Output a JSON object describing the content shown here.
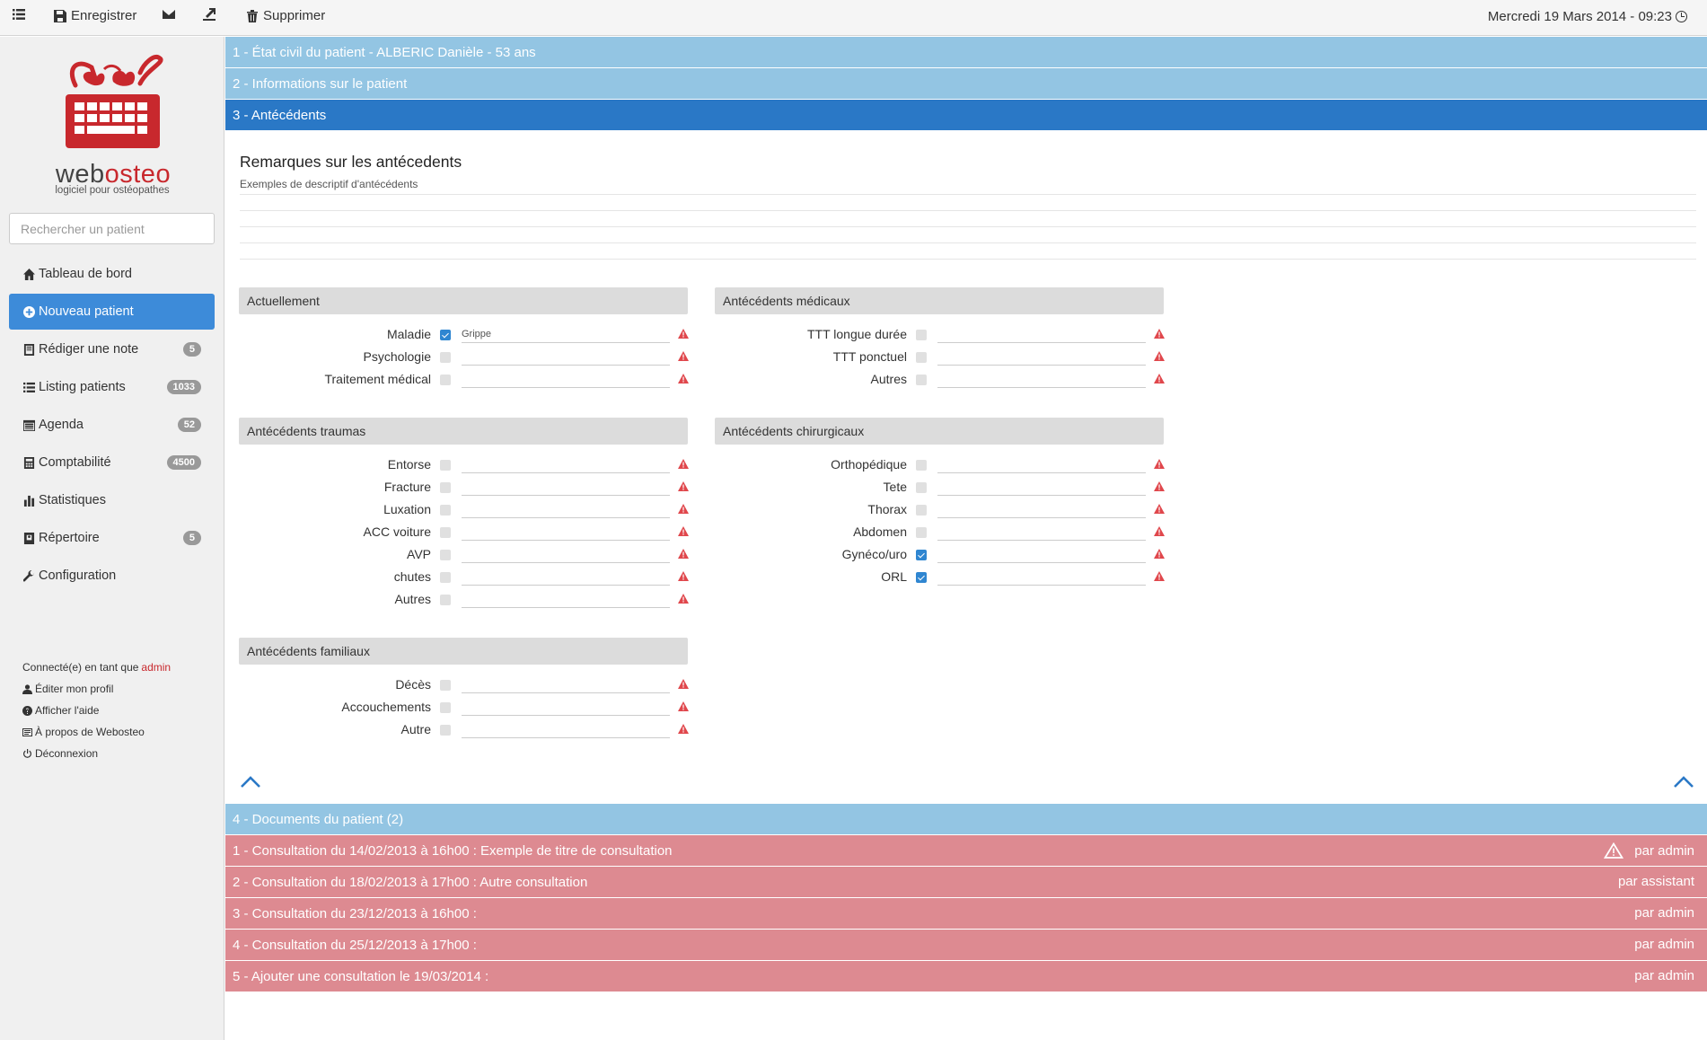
{
  "toolbar": {
    "save_label": "Enregistrer",
    "delete_label": "Supprimer",
    "datetime": "Mercredi 19 Mars 2014 - 09:23"
  },
  "brand": {
    "name_part1": "web",
    "name_part2": "osteo",
    "tagline": "logiciel pour ostéopathes"
  },
  "search": {
    "placeholder": "Rechercher un patient"
  },
  "nav": [
    {
      "label": "Tableau de bord",
      "icon": "home-icon"
    },
    {
      "label": "Nouveau patient",
      "icon": "plus-circle-icon",
      "active": true
    },
    {
      "label": "Rédiger une note",
      "icon": "note-icon",
      "badge": "5"
    },
    {
      "label": "Listing patients",
      "icon": "list-icon",
      "badge": "1033"
    },
    {
      "label": "Agenda",
      "icon": "calendar-icon",
      "badge": "52"
    },
    {
      "label": "Comptabilité",
      "icon": "calculator-icon",
      "badge": "4500"
    },
    {
      "label": "Statistiques",
      "icon": "bar-chart-icon"
    },
    {
      "label": "Répertoire",
      "icon": "book-icon",
      "badge": "5"
    },
    {
      "label": "Configuration",
      "icon": "wrench-icon"
    }
  ],
  "user": {
    "connected_prefix": "Connecté(e) en tant que",
    "username": "admin",
    "edit_profile": "Éditer mon profil",
    "help": "Afficher l'aide",
    "about": "À propos de Webosteo",
    "logout": "Déconnexion"
  },
  "panels": {
    "p1": "1 - État civil du patient - ALBERIC Danièle - 53 ans",
    "p2": "2 - Informations sur le patient",
    "p3": "3 - Antécédents",
    "p4": "4 - Documents du patient (2)"
  },
  "remarks": {
    "title": "Remarques sur les antécedents",
    "subtitle": "Exemples de descriptif d'antécédents"
  },
  "groups": {
    "actuellement": {
      "title": "Actuellement",
      "rows": [
        {
          "label": "Maladie",
          "checked": true,
          "value": "Grippe"
        },
        {
          "label": "Psychologie",
          "checked": false,
          "value": ""
        },
        {
          "label": "Traitement médical",
          "checked": false,
          "value": ""
        }
      ]
    },
    "medicaux": {
      "title": "Antécédents médicaux",
      "rows": [
        {
          "label": "TTT longue durée",
          "checked": false,
          "value": ""
        },
        {
          "label": "TTT ponctuel",
          "checked": false,
          "value": ""
        },
        {
          "label": "Autres",
          "checked": false,
          "value": ""
        }
      ]
    },
    "traumas": {
      "title": "Antécédents traumas",
      "rows": [
        {
          "label": "Entorse",
          "checked": false,
          "value": ""
        },
        {
          "label": "Fracture",
          "checked": false,
          "value": ""
        },
        {
          "label": "Luxation",
          "checked": false,
          "value": ""
        },
        {
          "label": "ACC voiture",
          "checked": false,
          "value": ""
        },
        {
          "label": "AVP",
          "checked": false,
          "value": ""
        },
        {
          "label": "chutes",
          "checked": false,
          "value": ""
        },
        {
          "label": "Autres",
          "checked": false,
          "value": ""
        }
      ]
    },
    "chirurgicaux": {
      "title": "Antécédents chirurgicaux",
      "rows": [
        {
          "label": "Orthopédique",
          "checked": false,
          "value": ""
        },
        {
          "label": "Tete",
          "checked": false,
          "value": ""
        },
        {
          "label": "Thorax",
          "checked": false,
          "value": ""
        },
        {
          "label": "Abdomen",
          "checked": false,
          "value": ""
        },
        {
          "label": "Gynéco/uro",
          "checked": true,
          "value": ""
        },
        {
          "label": "ORL",
          "checked": true,
          "value": ""
        }
      ]
    },
    "familiaux": {
      "title": "Antécédents familiaux",
      "rows": [
        {
          "label": "Décès",
          "checked": false,
          "value": ""
        },
        {
          "label": "Accouchements",
          "checked": false,
          "value": ""
        },
        {
          "label": "Autre",
          "checked": false,
          "value": ""
        }
      ]
    }
  },
  "consultations": [
    {
      "title": "1 - Consultation du 14/02/2013 à 16h00 : Exemple de titre de consultation",
      "author": "par admin",
      "warning": true
    },
    {
      "title": "2 - Consultation du 18/02/2013 à 17h00 : Autre consultation",
      "author": "par assistant",
      "warning": false
    },
    {
      "title": "3 - Consultation du 23/12/2013 à 16h00 :",
      "author": "par admin",
      "warning": false
    },
    {
      "title": "4 - Consultation du 25/12/2013 à 17h00 :",
      "author": "par admin",
      "warning": false
    },
    {
      "title": "5 - Ajouter une consultation le 19/03/2014 :",
      "author": "par admin",
      "warning": false
    }
  ],
  "colors": {
    "panel_light": "#93c5e3",
    "panel_active": "#2a78c6",
    "consultation": "#dd8a91",
    "brand_red": "#c8282d",
    "nav_active": "#3d8bd9",
    "warning": "#e0474c"
  }
}
